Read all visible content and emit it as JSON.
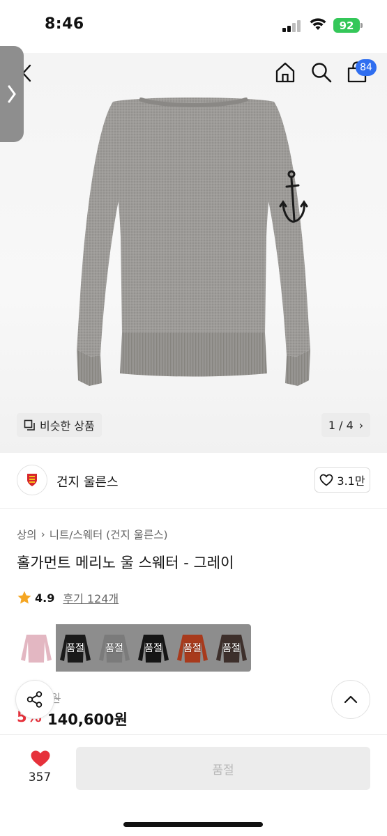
{
  "status_bar": {
    "time": "8:46",
    "battery": "92"
  },
  "nav": {
    "cart_count": "84"
  },
  "gallery": {
    "similar_label": "비슷한 상품",
    "page_indicator": "1 / 4",
    "page_arrow": "›"
  },
  "brand": {
    "name": "건지 울른스",
    "likes": "3.1만"
  },
  "breadcrumb": {
    "category": "상의",
    "separator": "›",
    "subcategory": "니트/스웨터 (건지 울른스)"
  },
  "product": {
    "title": "홀가먼트 메리노 울 스웨터 - 그레이",
    "rating": "4.9",
    "reviews": "후기 124개",
    "original_price": "0원",
    "discount": "5%",
    "price": "140,600원"
  },
  "swatches": [
    {
      "color": "#e3b7c2",
      "sold_out": ""
    },
    {
      "color": "#1a1a1a",
      "sold_out": "품절"
    },
    {
      "color": "#7b7b7b",
      "sold_out": "품절"
    },
    {
      "color": "#151515",
      "sold_out": "품절"
    },
    {
      "color": "#a83a1c",
      "sold_out": "품절"
    },
    {
      "color": "#3d2f2b",
      "sold_out": "품절"
    }
  ],
  "bottom": {
    "wish_count": "357",
    "soldout_button": "품절"
  },
  "colors": {
    "accent_red": "#e6313b",
    "badge_blue": "#2f6ef0",
    "battery_green": "#34c759"
  }
}
